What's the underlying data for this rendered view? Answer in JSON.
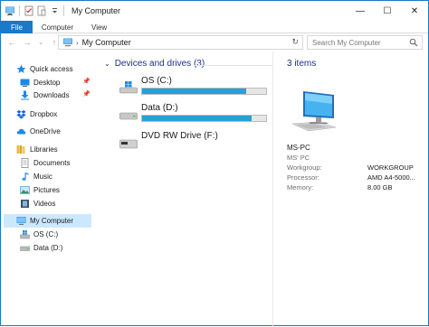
{
  "window": {
    "title": "My Computer",
    "minimize": "—",
    "maximize": "☐",
    "close": "✕"
  },
  "ribbon": {
    "tabs": [
      "File",
      "Computer",
      "View"
    ]
  },
  "nav": {
    "back": "←",
    "forward": "→",
    "recent": "⌄",
    "up": "↑",
    "address": "My Computer",
    "refresh": "↻",
    "search_placeholder": "Search My Computer"
  },
  "sidebar": {
    "items": [
      {
        "label": "Quick access"
      },
      {
        "label": "Desktop"
      },
      {
        "label": "Downloads"
      },
      {
        "label": "Dropbox"
      },
      {
        "label": "OneDrive"
      },
      {
        "label": "Libraries"
      },
      {
        "label": "Documents"
      },
      {
        "label": "Music"
      },
      {
        "label": "Pictures"
      },
      {
        "label": "Videos"
      },
      {
        "label": "My Computer"
      },
      {
        "label": "OS (C:)"
      },
      {
        "label": "Data (D:)"
      }
    ]
  },
  "content": {
    "group_title": "Devices and drives (3)",
    "drives": [
      {
        "name": "OS (C:)",
        "used_fraction": 0.84
      },
      {
        "name": "Data (D:)",
        "used_fraction": 0.88
      },
      {
        "name": "DVD RW Drive (F:)",
        "used_fraction": null
      }
    ]
  },
  "details": {
    "count": "3 items",
    "pc_name": "MS-PC",
    "props": [
      {
        "label": "MS' PC",
        "value": ""
      },
      {
        "label": "Workgroup:",
        "value": "WORKGROUP"
      },
      {
        "label": "Processor:",
        "value": "AMD A4-5000..."
      },
      {
        "label": "Memory:",
        "value": "8.00 GB"
      }
    ]
  },
  "colors": {
    "accent": "#1979ca",
    "bar_fill": "#26a0da",
    "group_header": "#1e3287",
    "selected": "#cce8ff"
  }
}
